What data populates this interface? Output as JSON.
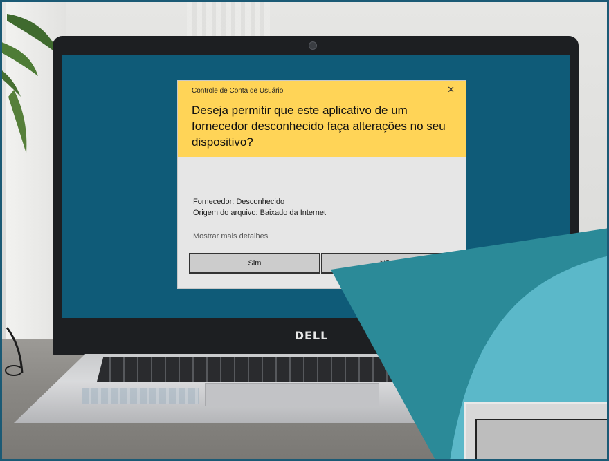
{
  "dialog": {
    "title": "Controle de Conta de Usuário",
    "close_glyph": "✕",
    "question": "Deseja permitir que este aplicativo de um fornecedor desconhecido faça alterações no seu dispositivo?",
    "publisher": "Fornecedor: Desconhecido",
    "origin": "Origem do arquivo: Baixado da Internet",
    "more_details": "Mostrar mais detalhes",
    "yes_label": "Sim",
    "no_label": "Não",
    "header_color": "#ffd457",
    "body_color": "#e6e6e6"
  },
  "laptop": {
    "brand": "DELL",
    "screen_color": "#0f5b78"
  },
  "overlay": {
    "teal_dark": "#2b8a98",
    "teal_light": "#5bb8c9",
    "frame_color": "#1b5a75"
  },
  "icons": {
    "close": "close-icon"
  }
}
